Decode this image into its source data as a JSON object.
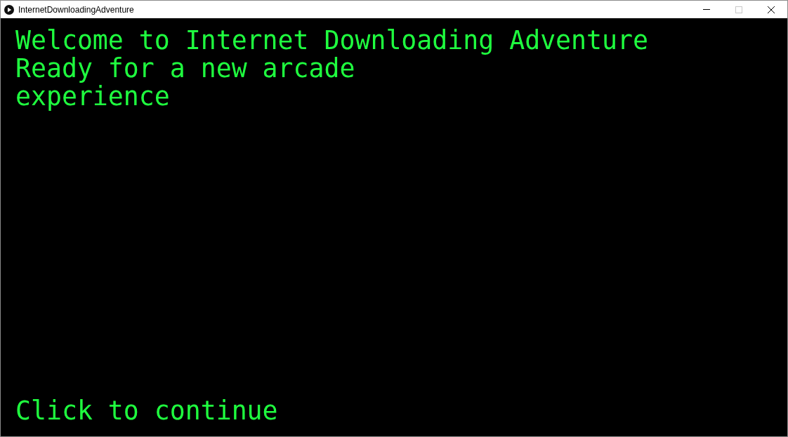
{
  "window": {
    "title": "InternetDownloadingAdventure",
    "maximize_disabled": true
  },
  "screen": {
    "lines": [
      "Welcome to Internet Downloading Adventure",
      "Ready for a new arcade experience"
    ],
    "prompt": "Click to continue"
  }
}
